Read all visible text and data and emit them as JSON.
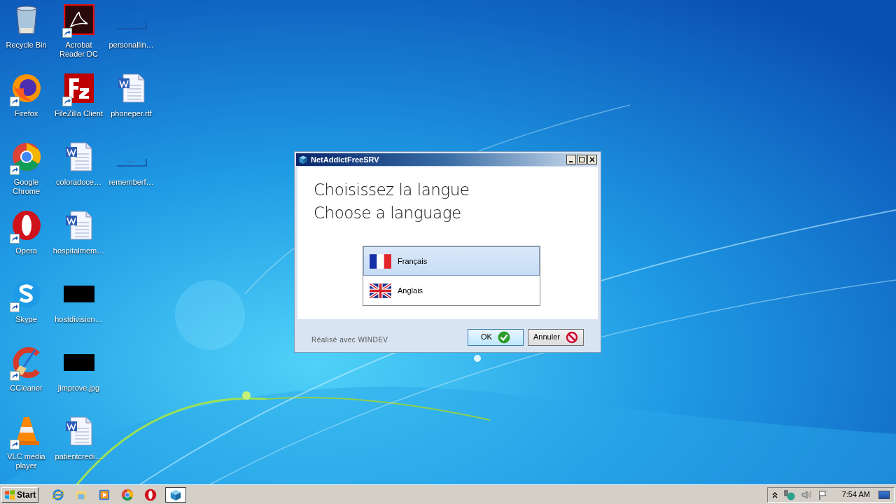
{
  "desktop": {
    "columns": [
      [
        {
          "label": "Recycle Bin",
          "kind": "bin",
          "shortcut": false
        },
        {
          "label": "Firefox",
          "kind": "firefox",
          "shortcut": true
        },
        {
          "label": "Google Chrome",
          "kind": "chrome",
          "shortcut": true
        },
        {
          "label": "Opera",
          "kind": "opera",
          "shortcut": true
        },
        {
          "label": "Skype",
          "kind": "skype",
          "shortcut": true
        },
        {
          "label": "CCleaner",
          "kind": "ccleaner",
          "shortcut": true
        },
        {
          "label": "VLC media player",
          "kind": "vlc",
          "shortcut": true
        }
      ],
      [
        {
          "label": "Acrobat Reader DC",
          "kind": "acrobat",
          "shortcut": true
        },
        {
          "label": "FileZilla Client",
          "kind": "filezilla",
          "shortcut": true
        },
        {
          "label": "coloradoce…",
          "kind": "word",
          "shortcut": false
        },
        {
          "label": "hospitalmem…",
          "kind": "word",
          "shortcut": false
        },
        {
          "label": "hostdivision…",
          "kind": "black",
          "shortcut": false
        },
        {
          "label": "jimprove.jpg",
          "kind": "black",
          "shortcut": false
        },
        {
          "label": "patientcredi…",
          "kind": "word",
          "shortcut": false
        }
      ],
      [
        {
          "label": "personallin…",
          "kind": "blank",
          "shortcut": false
        },
        {
          "label": "phoneper.rtf",
          "kind": "word",
          "shortcut": false
        },
        {
          "label": "rememberf…",
          "kind": "blank",
          "shortcut": false
        }
      ]
    ]
  },
  "dialog": {
    "title": "NetAddictFreeSRV",
    "headings": [
      "Choisissez la langue",
      "Choose a language"
    ],
    "languages": [
      {
        "label": "Français",
        "kind": "fr",
        "selected": true
      },
      {
        "label": "Anglais",
        "kind": "uk",
        "selected": false
      }
    ],
    "footer": "Réalisé avec WINDEV",
    "buttons": [
      {
        "label": "OK",
        "kind": "ok",
        "default": true
      },
      {
        "label": "Annuler",
        "kind": "cancel",
        "default": false
      }
    ]
  },
  "taskbar": {
    "start": "Start",
    "apps": [
      {
        "kind": "ie",
        "selected": false
      },
      {
        "kind": "explorer",
        "selected": false
      },
      {
        "kind": "media",
        "selected": false
      },
      {
        "kind": "chrome",
        "selected": false
      },
      {
        "kind": "opera",
        "selected": false
      },
      {
        "kind": "cube",
        "selected": true
      }
    ],
    "clock": "7:54 AM"
  }
}
